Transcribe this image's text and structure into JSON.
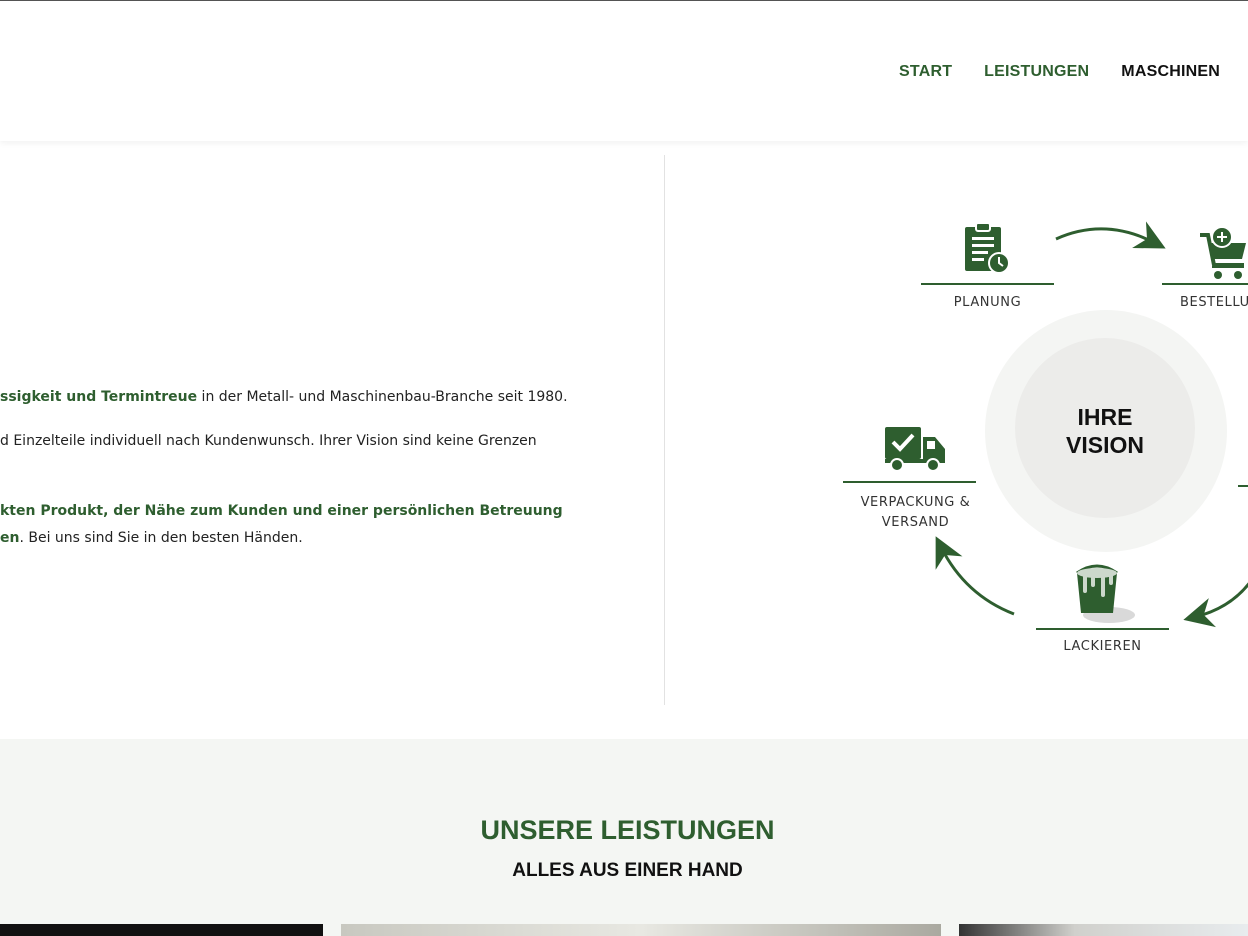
{
  "nav": {
    "items": [
      {
        "label": "START"
      },
      {
        "label": "LEISTUNGEN"
      },
      {
        "label": "MASCHINEN"
      }
    ]
  },
  "intro": {
    "line1_highlight": "ssigkeit und Termintreue",
    "line1_rest": " in der Metall- und Maschinenbau-Branche seit 1980.",
    "line2": "d Einzelteile individuell nach Kundenwunsch. Ihrer Vision sind keine Grenzen",
    "line3_highlight": "kten Produkt, der Nähe zum Kunden und einer persönlichen Betreuung",
    "line4_highlight": "en",
    "line4_rest": ". Bei uns sind Sie in den besten Händen."
  },
  "diagram": {
    "center_line1": "IHRE",
    "center_line2": "VISION",
    "steps": {
      "planung": "PLANUNG",
      "bestellung": "BESTELLU",
      "verpackung_line1": "VERPACKUNG &",
      "verpackung_line2": "VERSAND",
      "lackieren": "LACKIEREN"
    },
    "icons": [
      "clipboard-clock-icon",
      "shopping-cart-icon",
      "delivery-truck-icon",
      "paint-bucket-icon"
    ],
    "accent_color": "#2e5e2f"
  },
  "services": {
    "title": "UNSERE LEISTUNGEN",
    "subtitle": "ALLES AUS EINER HAND"
  }
}
